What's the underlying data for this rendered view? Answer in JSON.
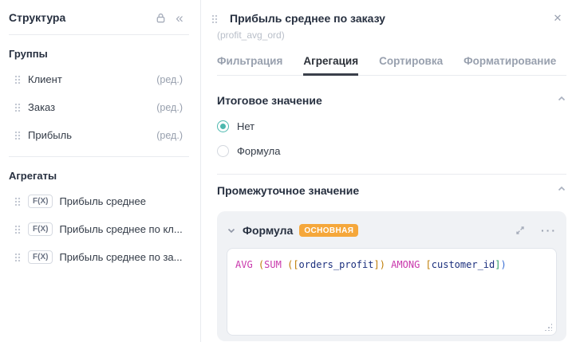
{
  "icons": {
    "collapse": "«",
    "close": "✕",
    "menu_dots": "···"
  },
  "colors": {
    "accent_teal": "#4cb8ae",
    "badge_orange": "#f5a73b",
    "code_keyword": "#c938ac",
    "code_identifier": "#1b2f7d",
    "code_bracket": "#bf7d05"
  },
  "sidebar": {
    "title": "Структура",
    "groups_header": "Группы",
    "groups": [
      {
        "label": "Клиент",
        "action": "(ред.)"
      },
      {
        "label": "Заказ",
        "action": "(ред.)"
      },
      {
        "label": "Прибыль",
        "action": "(ред.)"
      }
    ],
    "aggregates_header": "Агрегаты",
    "aggregates": [
      {
        "badge": "F(X)",
        "label": "Прибыль среднее"
      },
      {
        "badge": "F(X)",
        "label": "Прибыль среднее по кл..."
      },
      {
        "badge": "F(X)",
        "label": "Прибыль среднее по за..."
      }
    ]
  },
  "panel": {
    "title": "Прибыль среднее по заказу",
    "subtitle": "(profit_avg_ord)",
    "tabs": [
      {
        "label": "Фильтрация",
        "active": false
      },
      {
        "label": "Агрегация",
        "active": true
      },
      {
        "label": "Сортировка",
        "active": false
      },
      {
        "label": "Форматирование",
        "active": false
      }
    ],
    "total_section": {
      "title": "Итоговое значение",
      "options": [
        {
          "label": "Нет",
          "selected": true
        },
        {
          "label": "Формула",
          "selected": false
        }
      ]
    },
    "intermediate_section": {
      "title": "Промежуточное значение",
      "formula_label": "Формула",
      "badge": "ОСНОВНАЯ",
      "formula_text": "AVG (SUM ([orders_profit]) AMONG [customer_id])",
      "formula_tokens": [
        {
          "t": "AVG",
          "c": "kw"
        },
        {
          "t": " ",
          "c": ""
        },
        {
          "t": "(",
          "c": "b1"
        },
        {
          "t": "SUM",
          "c": "kw"
        },
        {
          "t": " ",
          "c": ""
        },
        {
          "t": "(",
          "c": "b1"
        },
        {
          "t": "[",
          "c": "b1"
        },
        {
          "t": "orders_profit",
          "c": "id"
        },
        {
          "t": "]",
          "c": "b1"
        },
        {
          "t": ")",
          "c": "b1"
        },
        {
          "t": " ",
          "c": ""
        },
        {
          "t": "AMONG",
          "c": "kw"
        },
        {
          "t": " ",
          "c": ""
        },
        {
          "t": "[",
          "c": "b1"
        },
        {
          "t": "customer_id",
          "c": "id"
        },
        {
          "t": "]",
          "c": "b2"
        },
        {
          "t": ")",
          "c": "b3"
        }
      ]
    }
  }
}
